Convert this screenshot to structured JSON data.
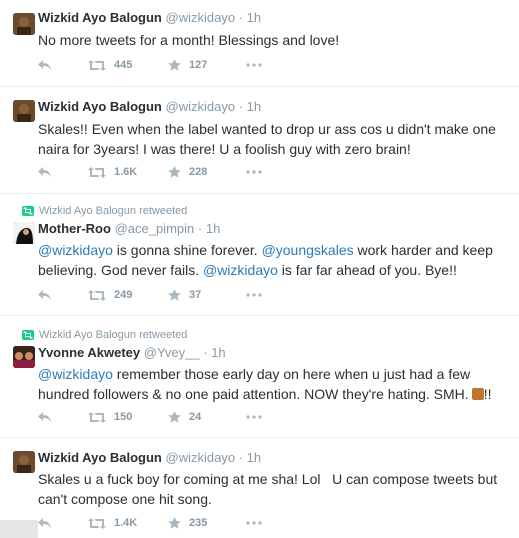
{
  "tweets": [
    {
      "retweeted_by": "",
      "name": "Wizkid Ayo Balogun",
      "handle": "@wizkidayo",
      "sep": "·",
      "time": "1h",
      "text_parts": [
        "No more tweets for a month! Blessings and love!"
      ],
      "retweets": "445",
      "favorites": "127"
    },
    {
      "retweeted_by": "",
      "name": "Wizkid Ayo Balogun",
      "handle": "@wizkidayo",
      "sep": "·",
      "time": "1h",
      "text_parts": [
        "Skales!! Even when the label wanted to drop ur ass cos u didn't make one naira for 3years! I was there! U a foolish guy with zero brain!"
      ],
      "retweets": "1.6K",
      "favorites": "228"
    },
    {
      "retweeted_by": "Wizkid Ayo Balogun retweeted",
      "name": "Mother-Roo",
      "handle": "@ace_pimpin",
      "sep": "·",
      "time": "1h",
      "text_parts": [
        "@wizkidayo",
        " is gonna shine forever. ",
        "@youngskales",
        " work harder and keep believing. God never fails. ",
        "@wizkidayo",
        " is far far ahead of you. Bye!!"
      ],
      "retweets": "249",
      "favorites": "37"
    },
    {
      "retweeted_by": "Wizkid Ayo Balogun retweeted",
      "name": "Yvonne Akwetey",
      "handle": "@Yvey__",
      "sep": "·",
      "time": "1h",
      "text_parts": [
        "@wizkidayo",
        " remember those early day on here when u just had a few hundred followers & no one paid attention. NOW they're hating. SMH.",
        "!!"
      ],
      "retweets": "150",
      "favorites": "24"
    },
    {
      "retweeted_by": "",
      "name": "Wizkid Ayo Balogun",
      "handle": "@wizkidayo",
      "sep": "·",
      "time": "1h",
      "text_parts": [
        "Skales u a fuck boy for coming at me sha! Lol   U can compose tweets but can't compose one hit song."
      ],
      "retweets": "1.4K",
      "favorites": "235"
    }
  ],
  "icons": {
    "reply": "reply-icon",
    "retweet": "retweet-icon",
    "favorite": "star-icon",
    "more": "more-dots-icon",
    "retweeted_badge": "retweet-badge-icon",
    "thumbs_down_emoji": "thumbs-down-emoji"
  },
  "colors": {
    "link": "#2b7bb9",
    "muted": "#8899a6",
    "retweet_green": "#19cf86",
    "text": "#292f33"
  }
}
